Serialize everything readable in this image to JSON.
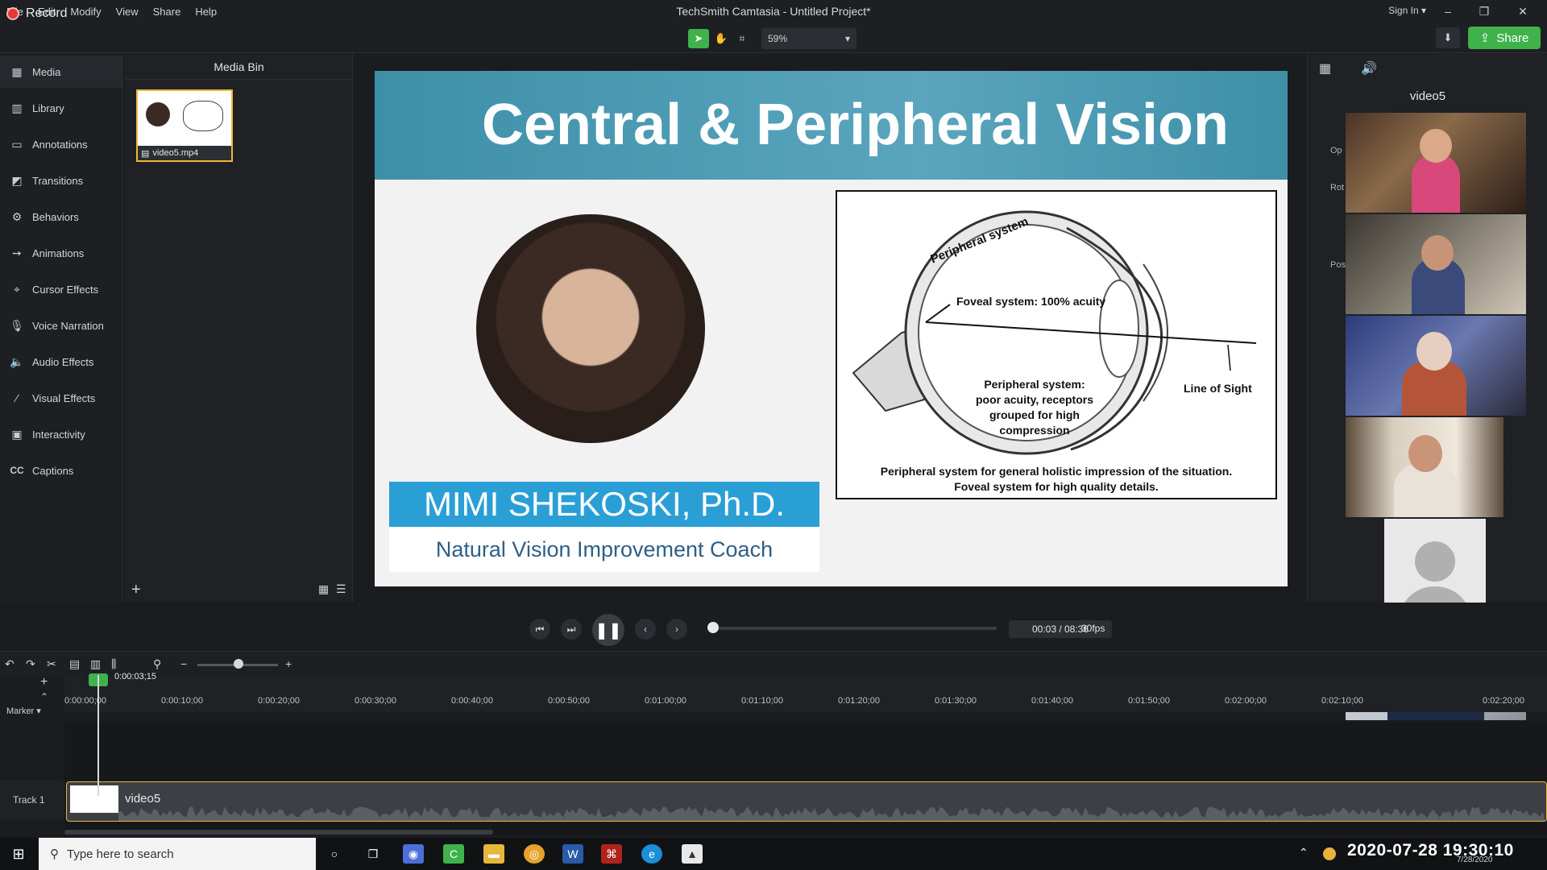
{
  "window": {
    "title": "TechSmith Camtasia - Untitled Project*",
    "menus": [
      "File",
      "Edit",
      "Modify",
      "View",
      "Share",
      "Help"
    ],
    "sign_in": "Sign In",
    "controls": {
      "minimize": "–",
      "maximize": "❐",
      "close": "✕"
    }
  },
  "toolbar": {
    "record_label": "Record",
    "zoom_value": "59%",
    "share_label": "Share",
    "accent_color": "#3fb24b",
    "record_color": "#e53935"
  },
  "sidebar": {
    "items": [
      {
        "label": "Media",
        "icon": "film-icon"
      },
      {
        "label": "Library",
        "icon": "library-icon"
      },
      {
        "label": "Annotations",
        "icon": "annotation-icon"
      },
      {
        "label": "Transitions",
        "icon": "transition-icon"
      },
      {
        "label": "Behaviors",
        "icon": "behavior-icon"
      },
      {
        "label": "Animations",
        "icon": "animation-icon"
      },
      {
        "label": "Cursor Effects",
        "icon": "cursor-icon"
      },
      {
        "label": "Voice Narration",
        "icon": "microphone-icon"
      },
      {
        "label": "Audio Effects",
        "icon": "speaker-icon"
      },
      {
        "label": "Visual Effects",
        "icon": "wand-icon"
      },
      {
        "label": "Interactivity",
        "icon": "interactivity-icon"
      },
      {
        "label": "Captions",
        "icon": "cc-icon"
      }
    ]
  },
  "media_bin": {
    "title": "Media Bin",
    "items": [
      {
        "name": "video5.mp4"
      }
    ]
  },
  "canvas": {
    "slide_title": "Central & Peripheral Vision",
    "presenter_name": "MIMI SHEKOSKI, Ph.D.",
    "presenter_role": "Natural Vision Improvement Coach",
    "diagram": {
      "label_peripheral": "Peripheral system",
      "label_foveal": "Foveal system: 100% acuity",
      "label_periph_desc": [
        "Peripheral system:",
        "poor acuity, receptors",
        "grouped for high",
        "compression"
      ],
      "label_line": "Line of Sight",
      "caption": [
        "Peripheral system for general holistic impression of the situation.",
        "Foveal system for high quality details."
      ]
    }
  },
  "properties": {
    "title": "video5",
    "labels": [
      "Op",
      "Rot",
      "Pos"
    ]
  },
  "playback": {
    "time": "00:03 / 08:36",
    "fps": "30fps"
  },
  "timeline": {
    "playhead": "0:00:03;15",
    "marker_label": "Marker",
    "ticks": [
      "0:00:00;00",
      "0:00:10;00",
      "0:00:20;00",
      "0:00:30;00",
      "0:00:40;00",
      "0:00:50;00",
      "0:01:00;00",
      "0:01:10;00",
      "0:01:20;00",
      "0:01:30;00",
      "0:01:40;00",
      "0:01:50;00",
      "0:02:00;00",
      "0:02:10;00",
      "0:02:20;00"
    ],
    "tracks": [
      {
        "name": "Track 1",
        "clip": "video5"
      }
    ]
  },
  "taskbar": {
    "search_placeholder": "Type here to search",
    "clock": "2020-07-28  19:30:10",
    "date_small": "7/28/2020"
  }
}
